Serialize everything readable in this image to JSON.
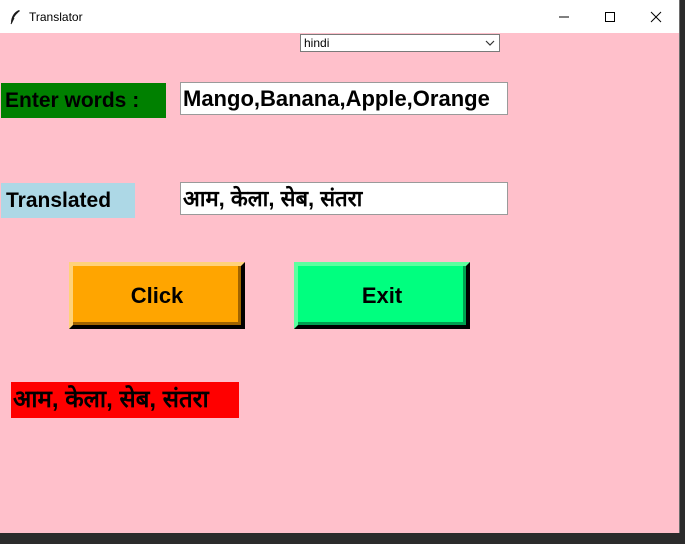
{
  "window": {
    "title": "Translator",
    "icon": "feather-icon",
    "controls": [
      "minimize-icon",
      "maximize-icon",
      "close-icon"
    ]
  },
  "language_select": {
    "value": "hindi"
  },
  "input_label": "Enter words :",
  "input_value": "Mango,Banana,Apple,Orange",
  "translated_label": "Translated",
  "translated_value": "आम, केला, सेब, संतरा",
  "buttons": {
    "click": "Click",
    "exit": "Exit"
  },
  "result_text": "आम, केला, सेब, संतरा",
  "colors": {
    "background": "#ffc0cb",
    "enter_label_bg": "#008000",
    "translated_label_bg": "#add8e6",
    "click_button_bg": "#ffa500",
    "exit_button_bg": "#00ff7f",
    "result_bg": "#ff0000"
  }
}
